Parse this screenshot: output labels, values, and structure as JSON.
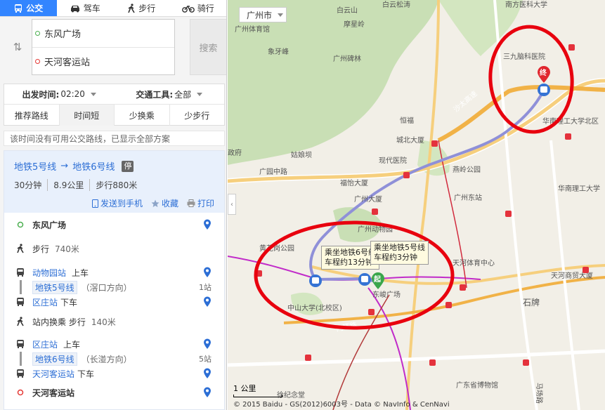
{
  "modes": [
    {
      "label": "公交",
      "icon": "bus-icon",
      "active": true
    },
    {
      "label": "驾车",
      "icon": "car-icon",
      "active": false
    },
    {
      "label": "步行",
      "icon": "walk-icon",
      "active": false
    },
    {
      "label": "骑行",
      "icon": "bike-icon",
      "active": false
    }
  ],
  "search": {
    "from": "东风广场",
    "to": "天河客运站",
    "button": "搜索"
  },
  "filters": {
    "depart_label": "出发时间:",
    "depart_value": "02:20",
    "tool_label": "交通工具:",
    "tool_value": "全部",
    "tabs": [
      "推荐路线",
      "时间短",
      "少换乘",
      "少步行"
    ]
  },
  "notice": "该时间没有可用公交路线，已显示全部方案",
  "plan": {
    "line_a": "地铁5号线",
    "arrow": "→",
    "line_b": "地铁6号线",
    "badge": "停",
    "duration": "30分钟",
    "distance": "8.9公里",
    "walk": "步行880米",
    "send_phone": "发送到手机",
    "favorite": "收藏",
    "print": "打印",
    "steps": {
      "origin": "东风广场",
      "walk1": "步行",
      "walk1_dist": "740米",
      "board1_station": "动物园站",
      "board1_action": "上车",
      "line1": "地铁5号线",
      "line1_dir": "（滘口方向）",
      "line1_stops": "1站",
      "alight1_station": "区庄站",
      "alight1_action": "下车",
      "transfer": "站内换乘 步行",
      "transfer_dist": "140米",
      "board2_station": "区庄站",
      "board2_action": "上车",
      "line2": "地铁6号线",
      "line2_dir": "（长湴方向）",
      "line2_stops": "5站",
      "alight2_station": "天河客运站",
      "alight2_action": "下车",
      "dest": "天河客运站"
    }
  },
  "map": {
    "city": "广州市",
    "labels": {
      "l1": "白云山",
      "l2": "白云松涛",
      "l3": "南方医科大学",
      "l4": "广州体育馆",
      "l5": "摩星岭",
      "l6": "象牙峰",
      "l7": "广州碑林",
      "l8": "三九脑科医院",
      "l9": "沙太高速",
      "l10": "华南理工大学北区",
      "l11": "城北大厦",
      "l12": "现代医院",
      "l13": "姑娘坝",
      "l14": "广园中路",
      "l15": "燕岭公园",
      "l16": "福怡大厦",
      "l17": "广州东站",
      "l18": "华南理工大学",
      "l19": "广州动物园",
      "l20": "黄花岗公园",
      "l21": "天河体育中心",
      "l22": "天河商贸大厦",
      "l23": "石牌",
      "l24": "中山大学(北校区)",
      "l25": "东峻广场",
      "l26": "内环路",
      "l27": "广东省博物馆",
      "l28": "马场路",
      "l29": "徐纪念堂",
      "l30": "政府",
      "l31": "广州大厦",
      "l32": "恒福"
    },
    "callout1": "乘坐地铁6号线\n车程约13分钟",
    "callout2": "乘坐地铁5号线\n车程约3分钟",
    "start_label": "起",
    "end_label": "终",
    "scale": "1 公里",
    "copyright": "© 2015 Baidu - GS(2012)6003号 - Data © NavInfo & CenNavi"
  },
  "colors": {
    "accent": "#3385ff",
    "route": "#8f90d8",
    "highlight": "#e8000e"
  }
}
